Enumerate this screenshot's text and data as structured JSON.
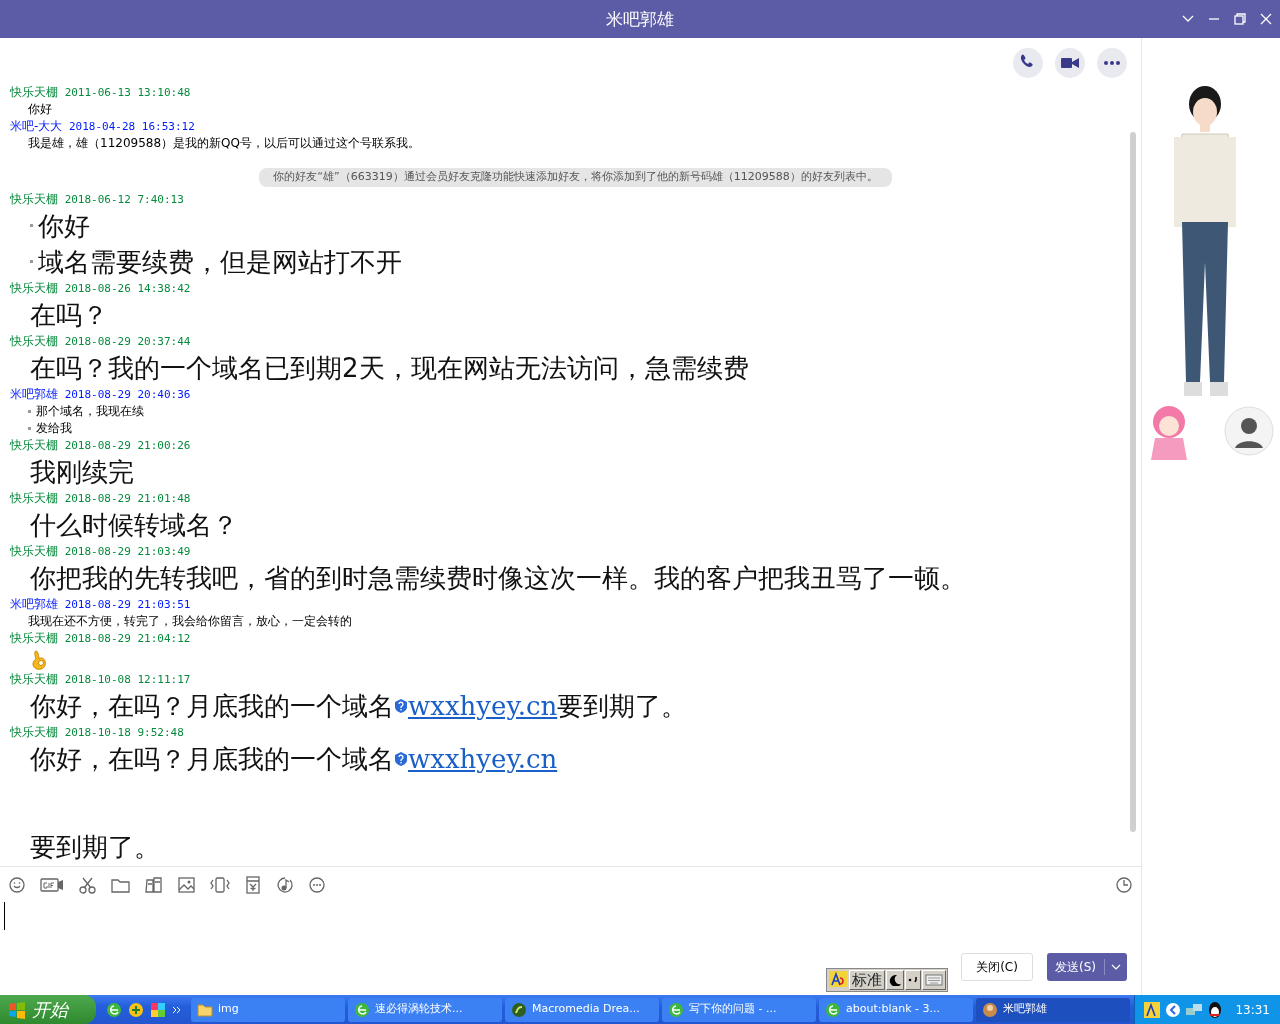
{
  "window": {
    "title": "米吧郭雄"
  },
  "messages": [
    {
      "kind": "small",
      "sender": "快乐天棚",
      "time": "2011-06-13 13:10:48",
      "color": "#068a3c",
      "bullets": false,
      "lines": [
        {
          "parts": [
            {
              "kind": "text",
              "text": "你好"
            }
          ]
        }
      ]
    },
    {
      "kind": "small",
      "sender": "米吧-大大",
      "time": "2018-04-28 16:53:12",
      "color": "#0018ff",
      "bullets": false,
      "lines": [
        {
          "parts": [
            {
              "kind": "text",
              "text": "我是雄，雄（11209588）是我的新QQ号，以后可以通过这个号联系我。"
            }
          ]
        }
      ]
    },
    {
      "kind": "notice",
      "text_before": "你的好友“雄”（663319）通过",
      "link": "会员好友克隆功能",
      "text_after": "快速添加好友，将你添加到了他的新号码雄（11209588）的好友列表中。"
    },
    {
      "kind": "large",
      "sender": "快乐天棚",
      "time": "2018-06-12 7:40:13",
      "color": "#068a3c",
      "bullets": true,
      "lines": [
        {
          "parts": [
            {
              "kind": "text",
              "text": "你好"
            }
          ]
        },
        {
          "parts": [
            {
              "kind": "text",
              "text": "域名需要续费，但是网站打不开"
            }
          ]
        }
      ]
    },
    {
      "kind": "large",
      "sender": "快乐天棚",
      "time": "2018-08-26 14:38:42",
      "color": "#068a3c",
      "bullets": false,
      "lines": [
        {
          "parts": [
            {
              "kind": "text",
              "text": "在吗？"
            }
          ]
        }
      ]
    },
    {
      "kind": "large",
      "sender": "快乐天棚",
      "time": "2018-08-29 20:37:44",
      "color": "#068a3c",
      "bullets": false,
      "lines": [
        {
          "parts": [
            {
              "kind": "text",
              "text": "在吗？我的一个域名已到期2天，现在网站无法访问，急需续费"
            }
          ]
        }
      ]
    },
    {
      "kind": "small",
      "sender": "米吧郭雄",
      "time": "2018-08-29 20:40:36",
      "color": "#0018ff",
      "bullets": true,
      "lines": [
        {
          "parts": [
            {
              "kind": "text",
              "text": "那个域名，我现在续"
            }
          ]
        },
        {
          "parts": [
            {
              "kind": "text",
              "text": "发给我"
            }
          ]
        }
      ]
    },
    {
      "kind": "large",
      "sender": "快乐天棚",
      "time": "2018-08-29 21:00:26",
      "color": "#068a3c",
      "bullets": false,
      "lines": [
        {
          "parts": [
            {
              "kind": "text",
              "text": "我刚续完"
            }
          ]
        }
      ]
    },
    {
      "kind": "large",
      "sender": "快乐天棚",
      "time": "2018-08-29 21:01:48",
      "color": "#068a3c",
      "bullets": false,
      "lines": [
        {
          "parts": [
            {
              "kind": "text",
              "text": "什么时候转域名？"
            }
          ]
        }
      ]
    },
    {
      "kind": "large",
      "sender": "快乐天棚",
      "time": "2018-08-29 21:03:49",
      "color": "#068a3c",
      "bullets": false,
      "lines": [
        {
          "parts": [
            {
              "kind": "text",
              "text": "你把我的先转我吧，省的到时急需续费时像这次一样。我的客户把我丑骂了一顿。"
            }
          ]
        }
      ]
    },
    {
      "kind": "small",
      "sender": "米吧郭雄",
      "time": "2018-08-29 21:03:51",
      "color": "#0018ff",
      "bullets": false,
      "lines": [
        {
          "parts": [
            {
              "kind": "text",
              "text": "我现在还不方便，转完了，我会给你留言，放心，一定会转的"
            }
          ]
        }
      ]
    },
    {
      "kind": "large",
      "sender": "快乐天棚",
      "time": "2018-08-29 21:04:12",
      "color": "#068a3c",
      "bullets": false,
      "lines": [
        {
          "parts": [
            {
              "kind": "emoji"
            }
          ]
        }
      ]
    },
    {
      "kind": "large",
      "sender": "快乐天棚",
      "time": "2018-10-08 12:11:17",
      "color": "#068a3c",
      "bullets": false,
      "lines": [
        {
          "parts": [
            {
              "kind": "text",
              "text": "你好，在吗？月底我的一个域名"
            },
            {
              "kind": "link",
              "text": "wxxhyey.cn"
            },
            {
              "kind": "text",
              "text": "要到期了。"
            }
          ]
        }
      ]
    },
    {
      "kind": "large",
      "sender": "快乐天棚",
      "time": "2018-10-18 9:52:48",
      "color": "#068a3c",
      "bullets": false,
      "lines": [
        {
          "parts": [
            {
              "kind": "text",
              "text": "你好，在吗？月底我的一个域名"
            },
            {
              "kind": "link",
              "text": "wxxhyey.cn"
            }
          ],
          "blank_before": false
        },
        {
          "parts": [
            {
              "kind": "text",
              "text": "要到期了。"
            }
          ],
          "blank_before": true
        }
      ]
    }
  ],
  "buttons": {
    "close": "关闭(C)",
    "send": "发送(S)"
  },
  "ime": {
    "mode": "标准"
  },
  "taskbar": {
    "start": "开始",
    "tasks": [
      {
        "label": "img",
        "selected": false
      },
      {
        "label": "速必得涡轮技术...",
        "selected": false
      },
      {
        "label": "Macromedia Drea...",
        "selected": false
      },
      {
        "label": "写下你的问题 - ...",
        "selected": false
      },
      {
        "label": "about:blank - 3...",
        "selected": false
      },
      {
        "label": "米吧郭雄",
        "selected": true
      }
    ],
    "clock": "13:31"
  }
}
